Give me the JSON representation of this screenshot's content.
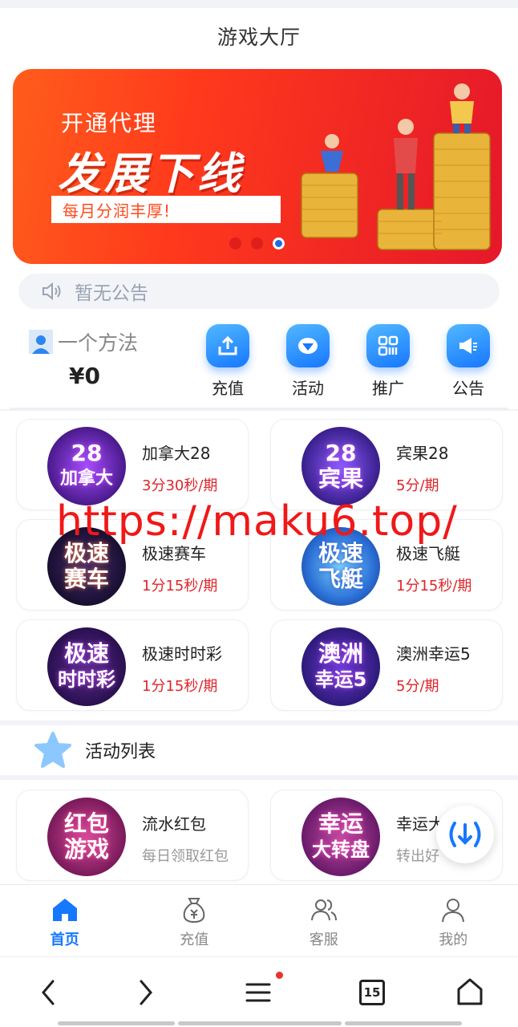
{
  "header": {
    "title": "游戏大厅"
  },
  "banner": {
    "line1": "开通代理",
    "line2": "发展下线",
    "pill": "每月分润丰厚!",
    "active_slide": 3,
    "slide_count": 3
  },
  "notice": {
    "text": "暂无公告"
  },
  "user": {
    "name": "一个方法",
    "balance": "¥0"
  },
  "actions": [
    {
      "label": "充值",
      "icon": "upload-icon"
    },
    {
      "label": "活动",
      "icon": "diamond-icon"
    },
    {
      "label": "推广",
      "icon": "qrcode-icon"
    },
    {
      "label": "公告",
      "icon": "megaphone-icon"
    }
  ],
  "games": [
    {
      "name": "加拿大28",
      "period": "3分30秒/期",
      "logo": [
        "28",
        "加拿大"
      ]
    },
    {
      "name": "宾果28",
      "period": "5分/期",
      "logo": [
        "28",
        "宾果"
      ]
    },
    {
      "name": "极速赛车",
      "period": "1分15秒/期",
      "logo": [
        "极速",
        "赛车"
      ]
    },
    {
      "name": "极速飞艇",
      "period": "1分15秒/期",
      "logo": [
        "极速",
        "飞艇"
      ]
    },
    {
      "name": "极速时时彩",
      "period": "1分15秒/期",
      "logo": [
        "极速",
        "时时彩"
      ]
    },
    {
      "name": "澳洲幸运5",
      "period": "5分/期",
      "logo": [
        "澳洲",
        "幸运5"
      ]
    }
  ],
  "watermark": "https://maku6.top/",
  "activity_section": {
    "title": "活动列表"
  },
  "activities": [
    {
      "name": "流水红包",
      "desc": "每日领取红包",
      "logo": [
        "红包",
        "游戏"
      ]
    },
    {
      "name": "幸运大",
      "desc": "转出好",
      "logo": [
        "幸运",
        "大转盘"
      ]
    }
  ],
  "tabbar": [
    {
      "label": "首页",
      "active": true
    },
    {
      "label": "充值",
      "active": false
    },
    {
      "label": "客服",
      "active": false
    },
    {
      "label": "我的",
      "active": false
    }
  ],
  "browser": {
    "tab_count": "15"
  },
  "colors": {
    "accent": "#1677ff",
    "period_red": "#e0252a",
    "banner_red": "#f22a22"
  }
}
